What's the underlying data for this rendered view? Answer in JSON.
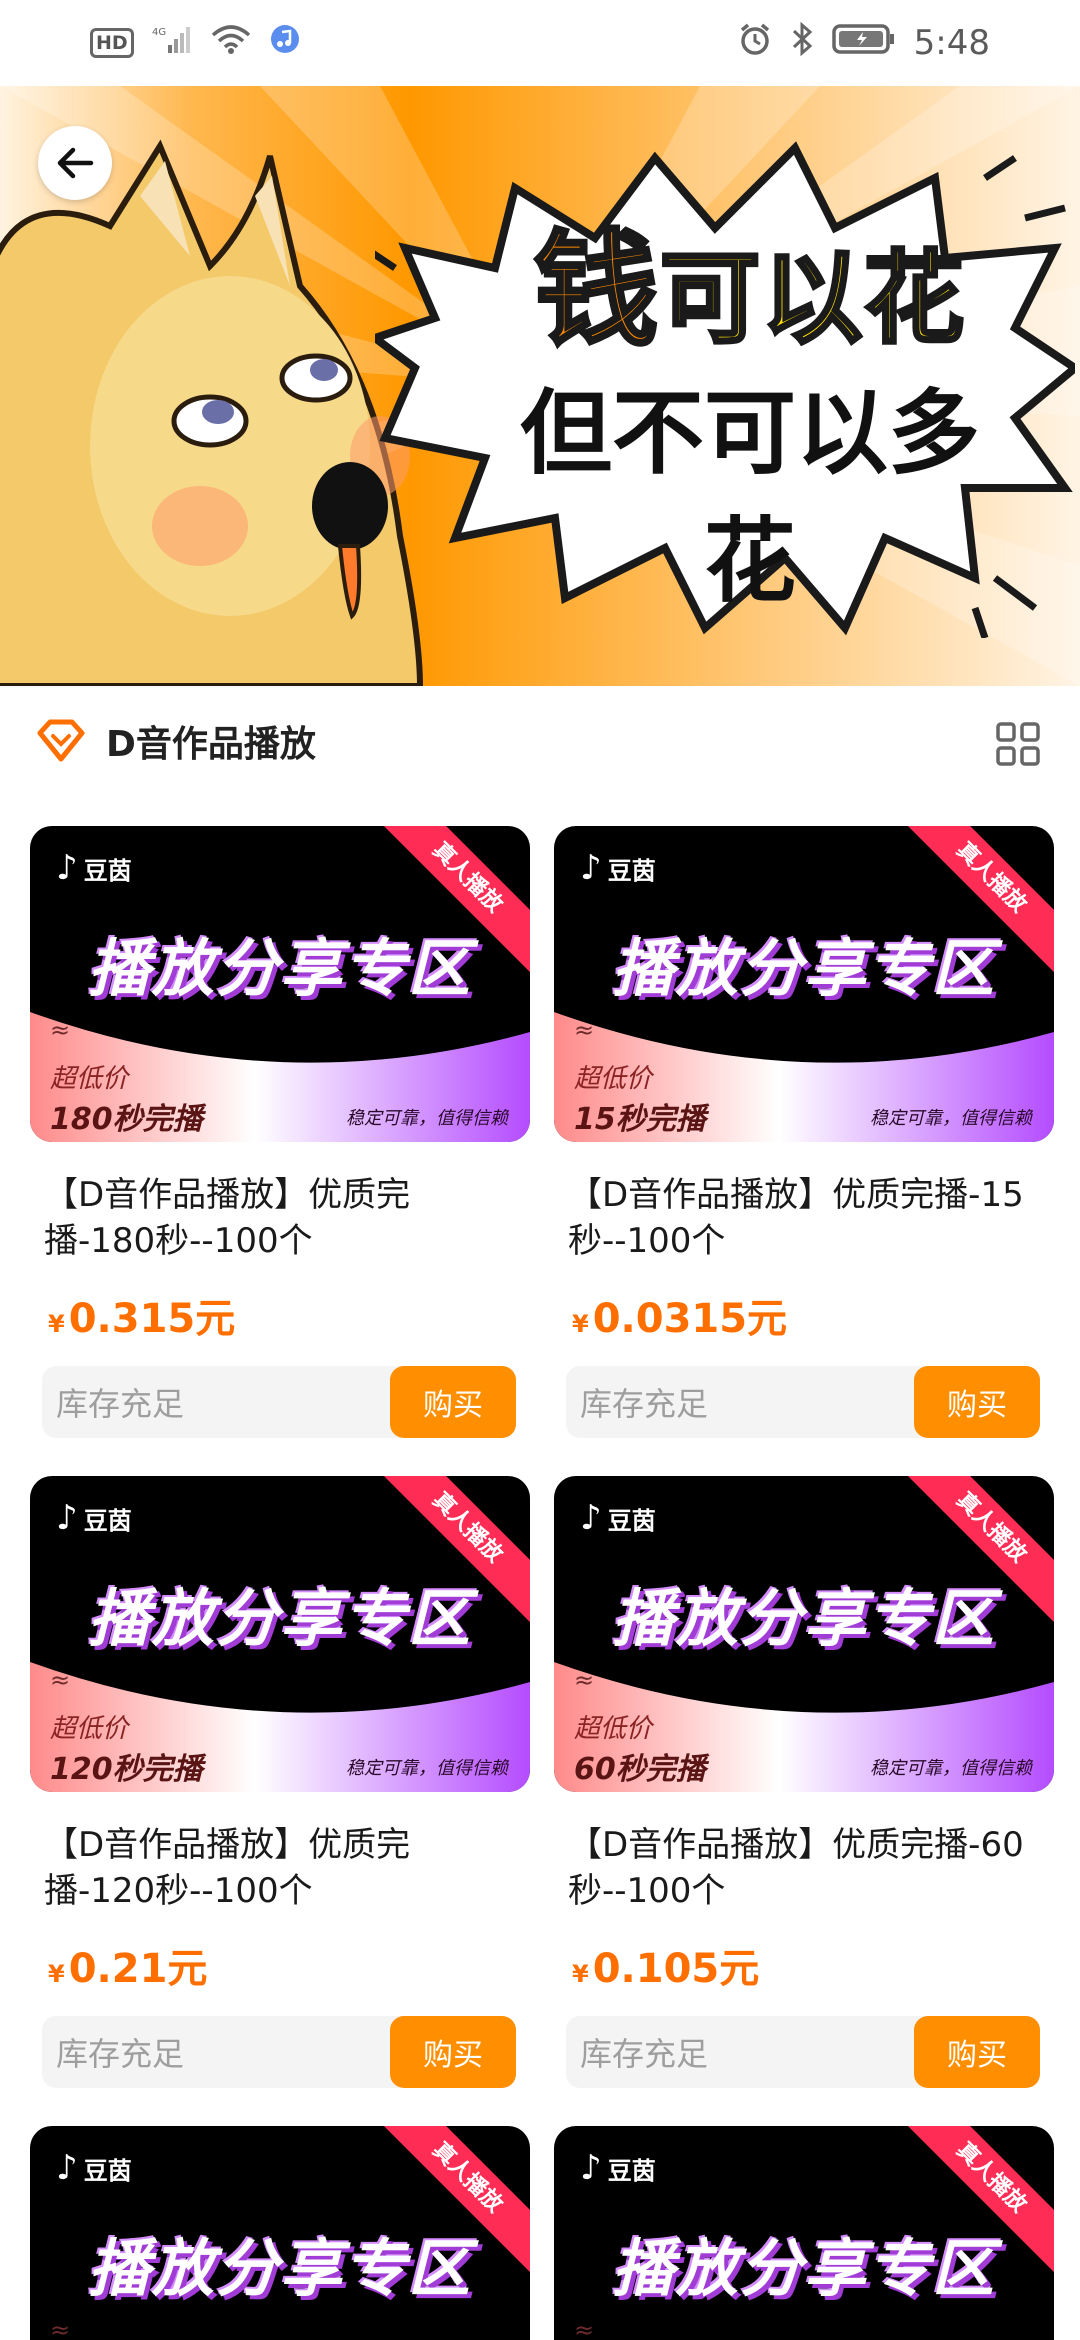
{
  "status_bar": {
    "hd": "HD",
    "network": "4G",
    "time": "5:48",
    "icons": [
      "signal-icon",
      "wifi-icon",
      "music-icon",
      "alarm-icon",
      "bluetooth-icon",
      "battery-icon"
    ]
  },
  "banner": {
    "line1_a": "钱",
    "line1_b": "可以花",
    "line2": "但不可以多花"
  },
  "section": {
    "title": "D音作品播放"
  },
  "thumb": {
    "logo": "豆茵",
    "ribbon": "真人播放",
    "zone": "播放分享专区",
    "approx": "≈",
    "low_price": "超低价",
    "trust": "稳定可靠，值得信赖"
  },
  "products": [
    {
      "duration": "180秒完播",
      "title": "【D音作品播放】优质完播-180秒--100个",
      "yen": "¥",
      "price": "0.315元",
      "stock": "库存充足",
      "buy": "购买"
    },
    {
      "duration": "15秒完播",
      "title": "【D音作品播放】优质完播-15秒--100个",
      "yen": "¥",
      "price": "0.0315元",
      "stock": "库存充足",
      "buy": "购买"
    },
    {
      "duration": "120秒完播",
      "title": "【D音作品播放】优质完播-120秒--100个",
      "yen": "¥",
      "price": "0.21元",
      "stock": "库存充足",
      "buy": "购买"
    },
    {
      "duration": "60秒完播",
      "title": "【D音作品播放】优质完播-60秒--100个",
      "yen": "¥",
      "price": "0.105元",
      "stock": "库存充足",
      "buy": "购买"
    }
  ],
  "colors": {
    "accent": "#ff8f00",
    "price": "#ff6f00",
    "ribbon": "#ff2d55"
  }
}
